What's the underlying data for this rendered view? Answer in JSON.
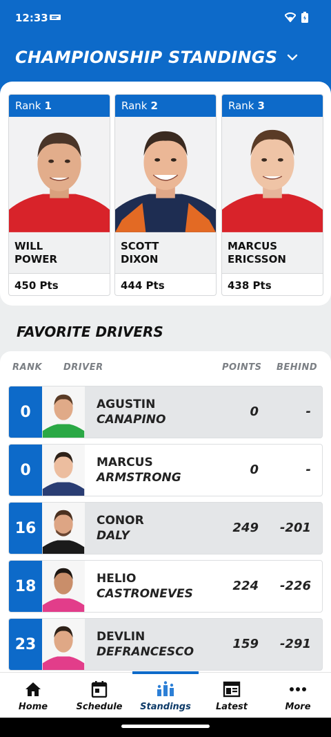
{
  "status_bar": {
    "time": "12:33"
  },
  "header": {
    "title": "CHAMPIONSHIP STANDINGS"
  },
  "top_three": [
    {
      "rank_label": "Rank",
      "rank": "1",
      "first": "WILL",
      "last": "POWER",
      "points": "450 Pts",
      "suit_color": "#d8232a"
    },
    {
      "rank_label": "Rank",
      "rank": "2",
      "first": "SCOTT",
      "last": "DIXON",
      "points": "444 Pts",
      "suit_color": "#1e2d52"
    },
    {
      "rank_label": "Rank",
      "rank": "3",
      "first": "MARCUS",
      "last": "ERICSSON",
      "points": "438 Pts",
      "suit_color": "#d8232a"
    }
  ],
  "favorites": {
    "title": "FAVORITE DRIVERS",
    "columns": {
      "rank": "RANK",
      "driver": "DRIVER",
      "points": "POINTS",
      "behind": "BEHIND"
    },
    "rows": [
      {
        "rank": "0",
        "first": "AGUSTIN",
        "last": "CANAPINO",
        "points": "0",
        "behind": "-",
        "suit_color": "#2aa845"
      },
      {
        "rank": "0",
        "first": "MARCUS",
        "last": "ARMSTRONG",
        "points": "0",
        "behind": "-",
        "suit_color": "#2a3d73"
      },
      {
        "rank": "16",
        "first": "CONOR",
        "last": "DALY",
        "points": "249",
        "behind": "-201",
        "suit_color": "#1b1b1b"
      },
      {
        "rank": "18",
        "first": "HELIO",
        "last": "CASTRONEVES",
        "points": "224",
        "behind": "-226",
        "suit_color": "#e23d8a"
      },
      {
        "rank": "23",
        "first": "DEVLIN",
        "last": "DEFRANCESCO",
        "points": "159",
        "behind": "-291",
        "suit_color": "#e23d8a"
      }
    ]
  },
  "nav": {
    "items": [
      {
        "label": "Home",
        "icon": "home-icon"
      },
      {
        "label": "Schedule",
        "icon": "calendar-icon"
      },
      {
        "label": "Standings",
        "icon": "standings-icon"
      },
      {
        "label": "Latest",
        "icon": "news-icon"
      },
      {
        "label": "More",
        "icon": "more-icon"
      }
    ],
    "active": "Standings"
  },
  "colors": {
    "brand_blue": "#0d6ac9",
    "background": "#eceeef"
  }
}
